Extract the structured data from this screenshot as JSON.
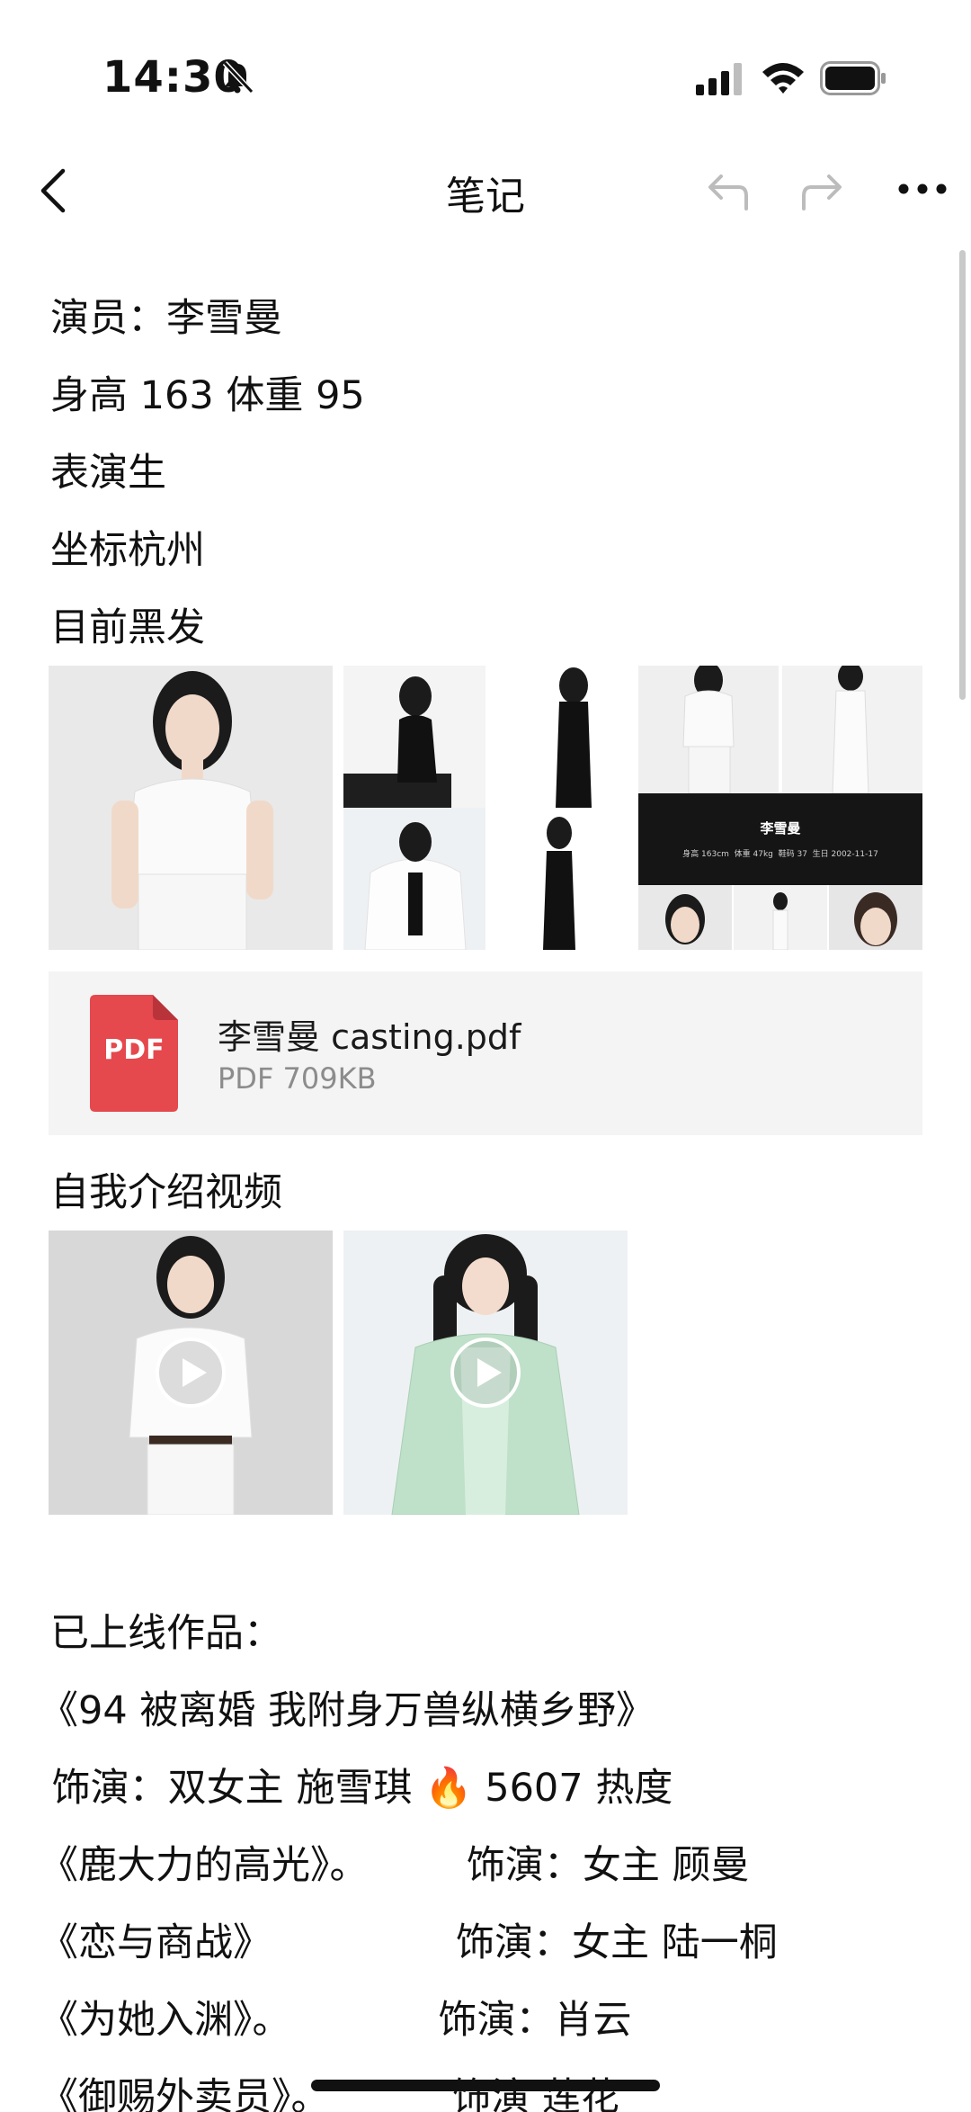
{
  "status_bar": {
    "time": "14:30"
  },
  "nav": {
    "title": "笔记"
  },
  "profile_lines": [
    "演员：李雪曼",
    "身高 163 体重 95",
    "表演生",
    "坐标杭州",
    "目前黑发"
  ],
  "images": {
    "comp_card_name": "李雪曼",
    "comp_card_stats": "身高 163cm  体重 47kg  鞋码 37  生日 2002-11-17"
  },
  "attachment": {
    "icon_label": "PDF",
    "filename": "李雪曼 casting.pdf",
    "meta": "PDF 709KB"
  },
  "video_section": {
    "title": "自我介绍视频"
  },
  "works": {
    "heading": "已上线作品：",
    "lines": [
      "《94 被离婚 我附身万兽纵横乡野》",
      " 饰演：双女主 施雪琪 🔥 5607 热度",
      "《鹿大力的高光》。        饰演：女主 顾曼",
      "《恋与商战》               饰演：女主 陆一桐",
      "《为她入渊》。            饰演：肖云",
      "《御赐外卖员》。          饰演 莲花"
    ]
  }
}
